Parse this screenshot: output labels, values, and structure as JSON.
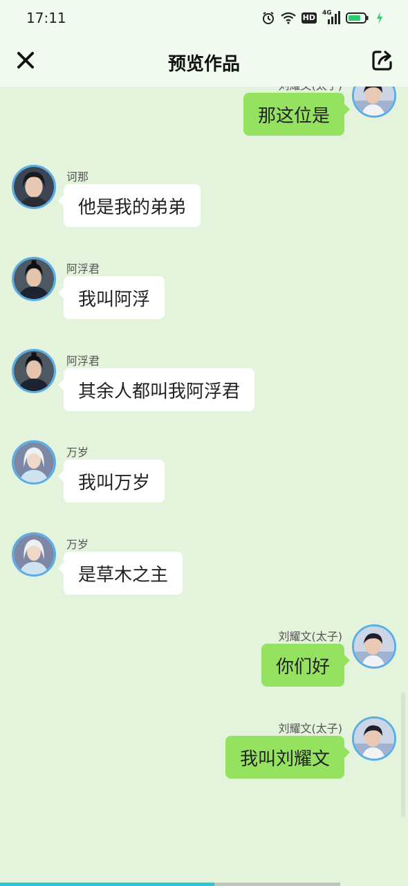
{
  "status_bar": {
    "time": "17:11",
    "hd_label": "HD",
    "network": "4G",
    "battery_color": "#2ecc71"
  },
  "navbar": {
    "title": "预览作品",
    "close_icon": "close-icon",
    "share_icon": "share-icon"
  },
  "messages": [
    {
      "side": "right",
      "name": "刘耀文(太子)",
      "text": "那这位是",
      "avatar": "liu-yaowen"
    },
    {
      "side": "left",
      "name": "诃那",
      "text": "他是我的弟弟",
      "avatar": "he-na"
    },
    {
      "side": "left",
      "name": "阿浮君",
      "text": "我叫阿浮",
      "avatar": "a-fu-jun"
    },
    {
      "side": "left",
      "name": "阿浮君",
      "text": "其余人都叫我阿浮君",
      "avatar": "a-fu-jun"
    },
    {
      "side": "left",
      "name": "万岁",
      "text": "我叫万岁",
      "avatar": "wan-sui"
    },
    {
      "side": "left",
      "name": "万岁",
      "text": "是草木之主",
      "avatar": "wan-sui"
    },
    {
      "side": "right",
      "name": "刘耀文(太子)",
      "text": "你们好",
      "avatar": "liu-yaowen"
    },
    {
      "side": "right",
      "name": "刘耀文(太子)",
      "text": "我叫刘耀文",
      "avatar": "liu-yaowen"
    }
  ],
  "playback": {
    "progress": 0.63
  },
  "colors": {
    "background": "#e4f3dc",
    "right_bubble": "#95e261",
    "left_bubble": "#ffffff",
    "avatar_ring": "#5aaee6",
    "progress": "#2fc3d6"
  }
}
